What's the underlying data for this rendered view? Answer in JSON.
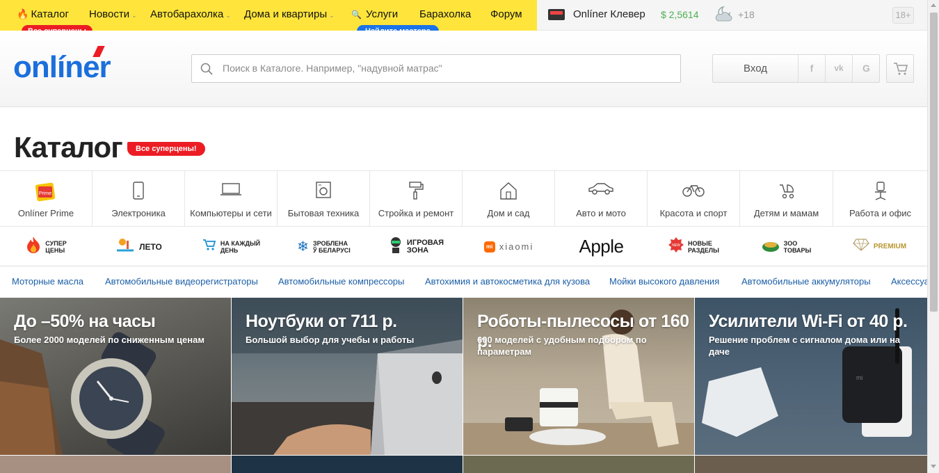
{
  "topnav": {
    "items": [
      {
        "label": "Каталог",
        "icon": "fire-icon"
      },
      {
        "label": "Новости",
        "dropdown": true
      },
      {
        "label": "Автобарахолка",
        "dropdown": true
      },
      {
        "label": "Дома и квартиры",
        "dropdown": true
      },
      {
        "label": "Услуги",
        "icon": "wrench-icon"
      },
      {
        "label": "Барахолка"
      },
      {
        "label": "Форум"
      }
    ],
    "catalog_badge": "Все суперцены",
    "services_badge": "Найдите мастера",
    "clever_label": "Onlíner Клевер",
    "currency_rate": "$ 2,5614",
    "temperature": "+18",
    "age_limit": "18+",
    "accent_yellow": "#ffe53b",
    "accent_red": "#ec1c24",
    "accent_blue": "#1a73e8"
  },
  "header": {
    "logo_text": "onlíner",
    "search_placeholder": "Поиск в Каталоге. Например, \"надувной матрас\"",
    "login_label": "Вход",
    "social": [
      "f",
      "vk",
      "G"
    ],
    "brand_color": "#1b6fdc"
  },
  "catalog": {
    "title": "Каталог",
    "badge": "Все суперцены!",
    "categories": [
      {
        "label": "Onlíner Prime",
        "icon": "prime-icon"
      },
      {
        "label": "Электроника",
        "icon": "phone-icon"
      },
      {
        "label": "Компьютеры и сети",
        "icon": "laptop-icon"
      },
      {
        "label": "Бытовая техника",
        "icon": "washer-icon"
      },
      {
        "label": "Стройка и ремонт",
        "icon": "paint-roller-icon"
      },
      {
        "label": "Дом и сад",
        "icon": "house-icon"
      },
      {
        "label": "Авто и мото",
        "icon": "car-icon"
      },
      {
        "label": "Красота и спорт",
        "icon": "bicycle-icon"
      },
      {
        "label": "Детям и мамам",
        "icon": "stroller-icon"
      },
      {
        "label": "Работа и офис",
        "icon": "office-chair-icon"
      }
    ],
    "promos": [
      {
        "line1": "СУПЕР",
        "line2": "ЦЕНЫ",
        "icon": "flame-icon"
      },
      {
        "line1": "ЛЕТО",
        "line2": "",
        "icon": "summer-icon"
      },
      {
        "line1": "НА КАЖДЫЙ",
        "line2": "ДЕНЬ",
        "icon": "cart-icon"
      },
      {
        "line1": "ЗРОБЛЕНА",
        "line2": "Ў БЕЛАРУСІ",
        "icon": "snowflake-icon"
      },
      {
        "line1": "ИГРОВАЯ",
        "line2": "ЗОНА",
        "icon": "gamer-icon"
      },
      {
        "line1": "xiaomi",
        "line2": "",
        "icon": "mi-icon"
      },
      {
        "line1": "Apple",
        "line2": "",
        "icon": "apple-text"
      },
      {
        "line1": "НОВЫЕ",
        "line2": "РАЗДЕЛЫ",
        "icon": "new-badge-icon"
      },
      {
        "line1": "ЗОО",
        "line2": "ТОВАРЫ",
        "icon": "pet-food-icon"
      },
      {
        "line1": "PREMIUM",
        "line2": "",
        "icon": "diamond-icon"
      }
    ],
    "quick_links": [
      "Моторные масла",
      "Автомобильные видеорегистраторы",
      "Автомобильные компрессоры",
      "Автохимия и автокосметика для кузова",
      "Мойки высокого давления",
      "Автомобильные аккумуляторы",
      "Аксессуары"
    ],
    "banners": [
      {
        "title": "До –50% на часы",
        "subtitle": "Более 2000 моделей по сниженным ценам"
      },
      {
        "title": "Ноутбуки от 711 р.",
        "subtitle": "Большой выбор для учебы и работы"
      },
      {
        "title": "Роботы-пылесосы от 160 р.",
        "subtitle": "600 моделей с удобным подбором по параметрам"
      },
      {
        "title": "Усилители Wi-Fi от 40 р.",
        "subtitle": "Решение проблем с сигналом дома или на даче"
      }
    ]
  }
}
